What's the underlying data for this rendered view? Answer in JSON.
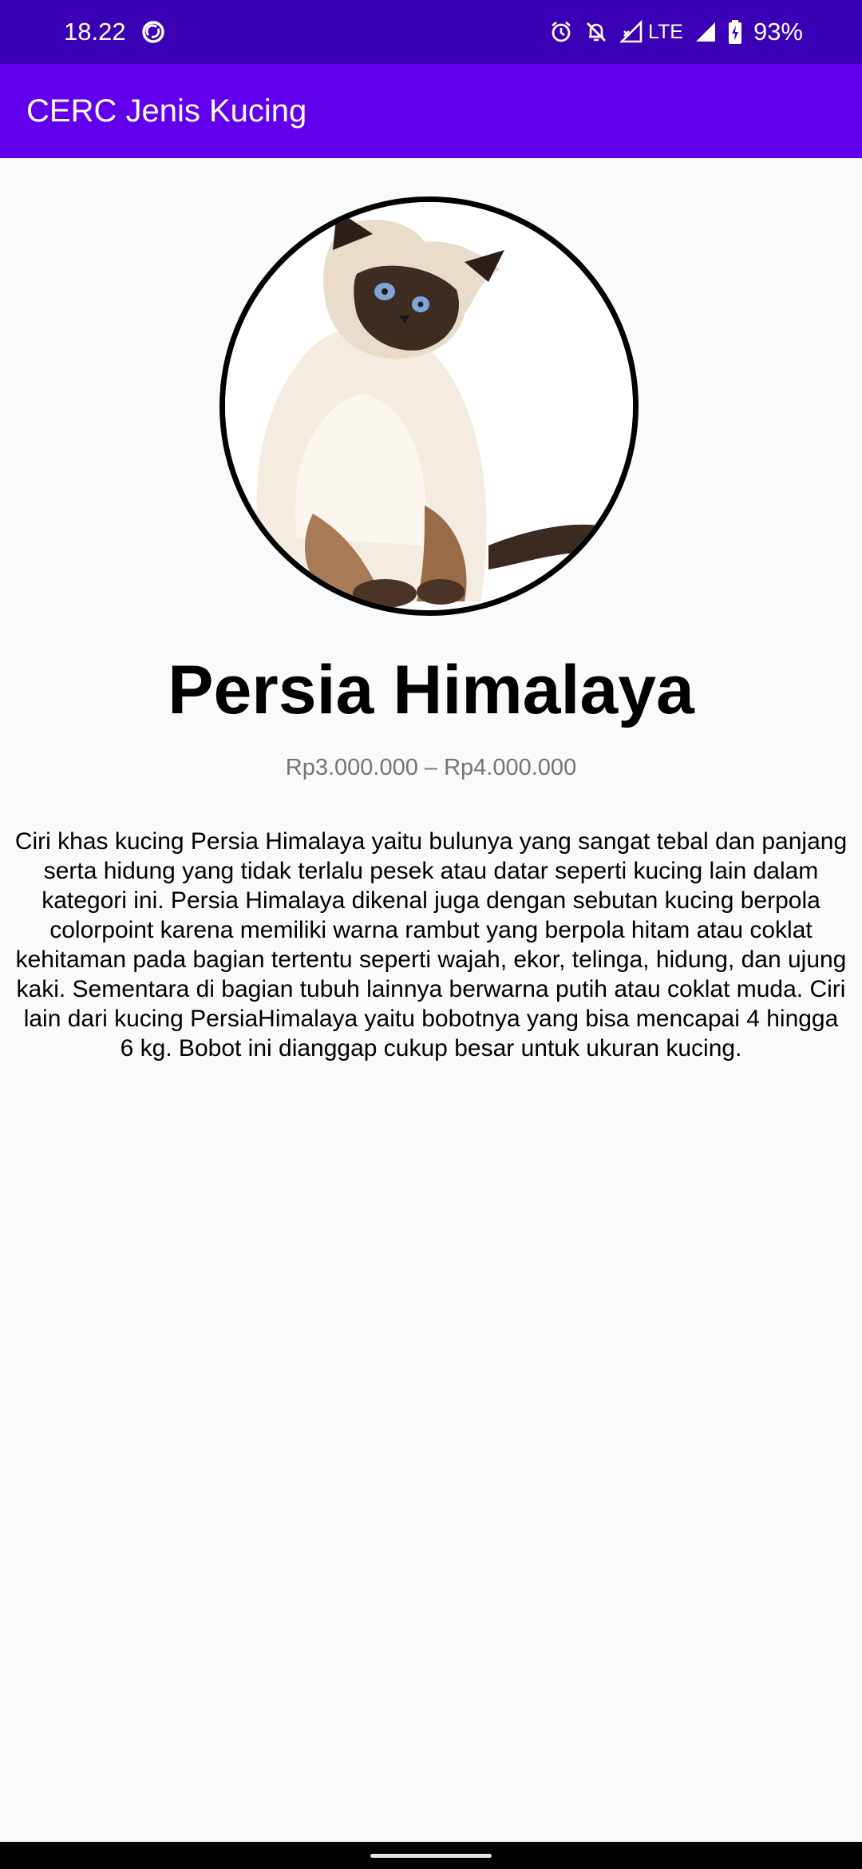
{
  "status_bar": {
    "time": "18.22",
    "network_type": "LTE",
    "battery": "93%",
    "icons": [
      "sync-icon",
      "alarm-icon",
      "notifications-off-icon",
      "signal-icon",
      "battery-icon"
    ],
    "background": "#3b00b6"
  },
  "app_bar": {
    "title": "CERC Jenis Kucing",
    "background": "#6200ee"
  },
  "cat": {
    "image": "himalayan-cat-photo",
    "name": "Persia Himalaya",
    "price": "Rp3.000.000 – Rp4.000.000",
    "description": "Ciri khas kucing Persia Himalaya yaitu bulunya yang sangat tebal dan panjang serta hidung yang tidak terlalu pesek atau datar seperti kucing lain dalam kategori ini. Persia Himalaya dikenal juga dengan sebutan kucing berpola colorpoint karena memiliki warna rambut yang berpola hitam atau coklat kehitaman pada bagian tertentu seperti wajah, ekor, telinga, hidung, dan ujung kaki. Sementara di bagian tubuh lainnya berwarna putih atau coklat muda. Ciri lain dari kucing PersiaHimalaya yaitu bobotnya yang bisa mencapai 4 hingga 6 kg. Bobot ini dianggap cukup besar untuk ukuran kucing."
  }
}
